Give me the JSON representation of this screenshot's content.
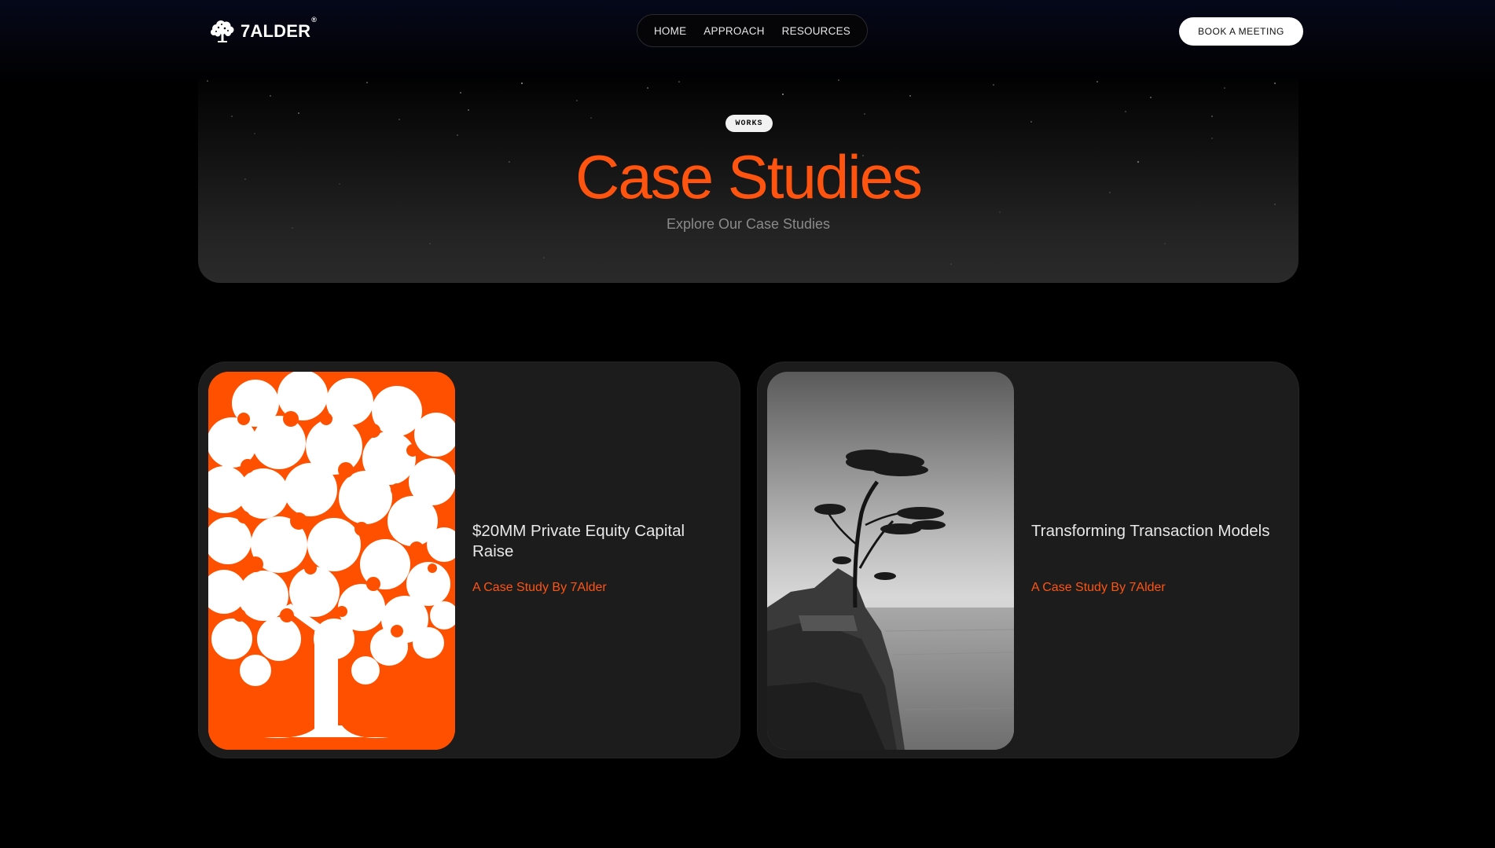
{
  "header": {
    "logo_text": "7ALDER",
    "logo_reg": "®",
    "nav": [
      "HOME",
      "APPROACH",
      "RESOURCES"
    ],
    "cta_label": "BOOK A MEETING"
  },
  "hero": {
    "badge": "WORKS",
    "title": "Case Studies",
    "subtitle": "Explore Our Case Studies"
  },
  "cards": [
    {
      "title": "$20MM Private Equity Capital Raise",
      "subtitle": "A Case Study By 7Alder",
      "image": "orange-tree-illustration"
    },
    {
      "title": "Transforming Transaction Models",
      "subtitle": "A Case Study By 7Alder",
      "image": "cypress-tree-on-cliff-photo"
    }
  ],
  "colors": {
    "accent": "#ff5410",
    "background": "#000000",
    "card": "#1c1c1c"
  }
}
